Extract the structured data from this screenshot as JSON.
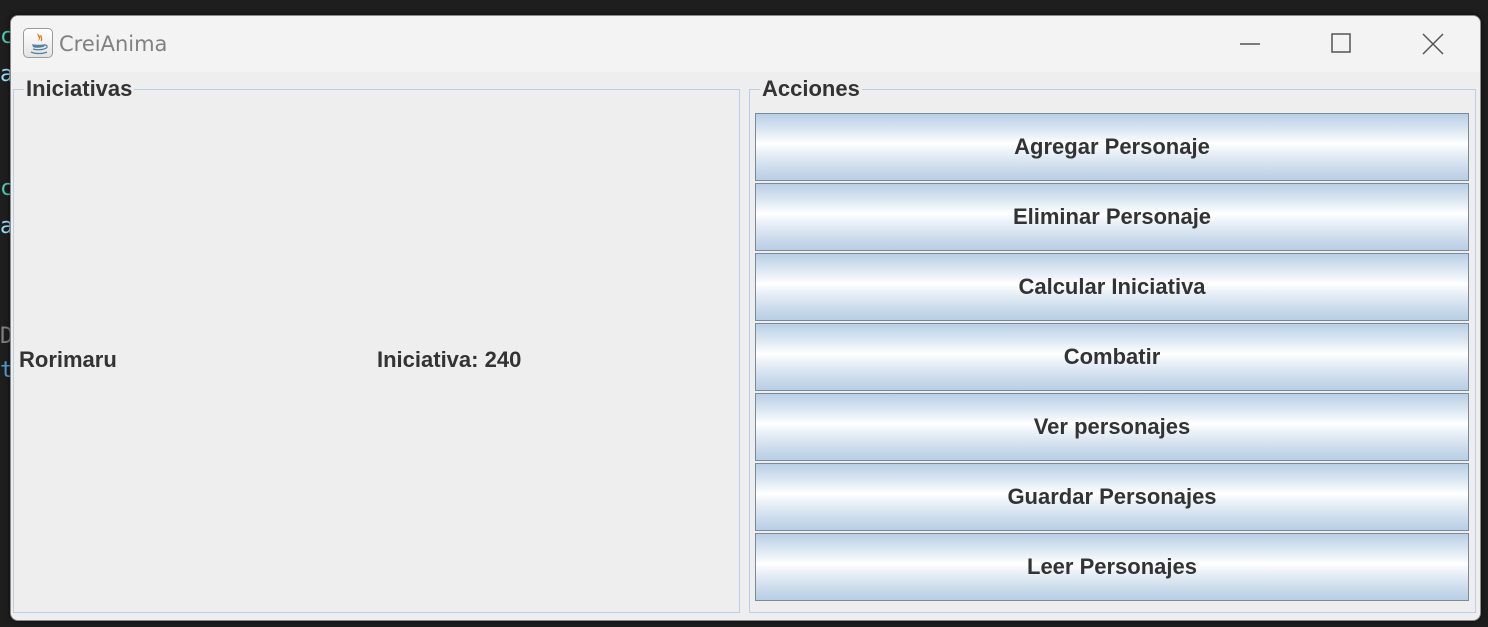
{
  "window": {
    "title": "CreiAnima"
  },
  "background_editor": {
    "fragments": [
      "c",
      "a",
      "c",
      "a",
      "D",
      "t"
    ]
  },
  "iniciativas": {
    "title": "Iniciativas",
    "entries": [
      {
        "name": "Rorimaru",
        "iniciativa": "Iniciativa: 240"
      }
    ]
  },
  "acciones": {
    "title": "Acciones",
    "buttons": [
      "Agregar Personaje",
      "Eliminar Personaje",
      "Calcular Iniciativa",
      "Combatir",
      "Ver personajes",
      "Guardar Personajes",
      "Leer Personajes"
    ]
  },
  "colors": {
    "border_accent": "#b8cfe5",
    "text": "#333333",
    "panel_bg": "#eeeeee"
  }
}
